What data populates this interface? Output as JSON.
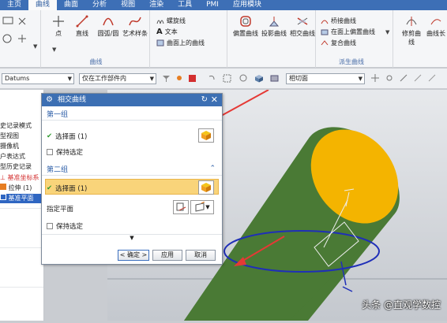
{
  "menu": {
    "tabs": [
      "主页",
      "曲线",
      "曲面",
      "分析",
      "视图",
      "渲染",
      "工具",
      "PMI",
      "应用模块"
    ],
    "active_index": 1
  },
  "ribbon": {
    "curve_group": {
      "label": "曲线",
      "buttons": [
        "点",
        "直线",
        "圆弧/圆",
        "艺术样条"
      ],
      "small": [
        "螺旋线",
        "文本",
        "曲面上的曲线"
      ]
    },
    "derived_group": {
      "label": "派生曲线",
      "buttons": [
        "偏置曲线",
        "投影曲线",
        "相交曲线"
      ],
      "small": [
        "桥接曲线",
        "在面上偏置曲线",
        "复合曲线"
      ]
    },
    "edit_group": {
      "buttons": [
        "修剪曲线",
        "曲线长"
      ]
    }
  },
  "selbar": {
    "filter": "Datums",
    "scope": "仅在工作部件内",
    "snap": "相切面"
  },
  "navigator": {
    "rows": [
      "史记录模式",
      "型视图",
      "摄像机",
      "户表达式",
      "型历史记录",
      "基准坐标系",
      "拉伸 (1)",
      "基准平面"
    ]
  },
  "dialog": {
    "title": "相交曲线",
    "group1": {
      "title": "第一组",
      "select": "选择面 (1)",
      "keep": "保持选定"
    },
    "group2": {
      "title": "第二组",
      "select": "选择面 (1)",
      "plane": "指定平面",
      "keep": "保持选定"
    },
    "ok": "< 确定 >",
    "apply": "应用",
    "cancel": "取消"
  },
  "watermark": "头条 @直观学数控",
  "colors": {
    "menu_bar": "#3d6fb6",
    "cylinder": "#4a7a35",
    "cylinder_top": "#f4b400",
    "arrow": "#e53935",
    "highlight_row": "#f9d47a",
    "intersection_curve": "#1f2fb8"
  }
}
